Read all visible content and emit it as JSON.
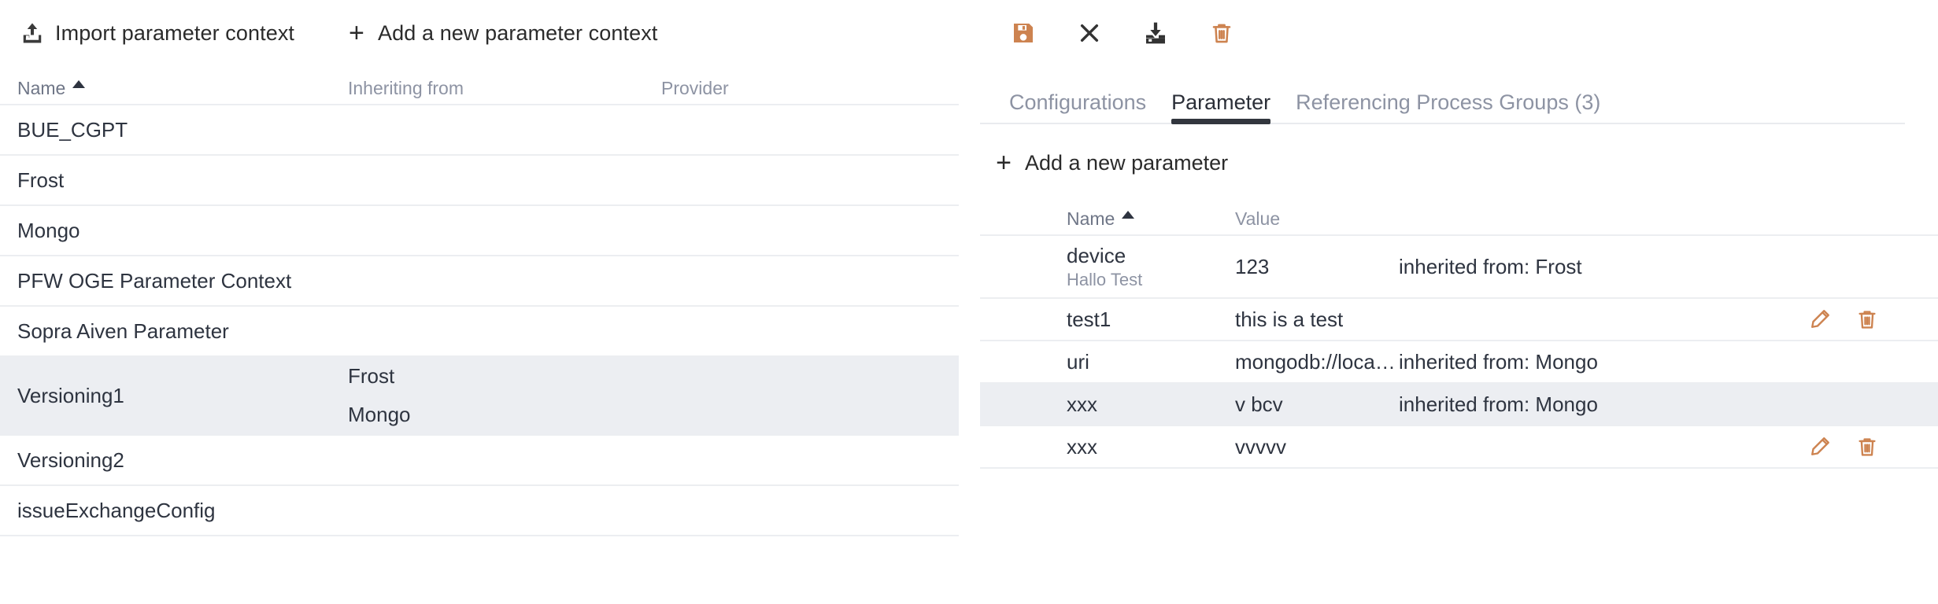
{
  "theme": {
    "accent_orange": "#cd8350",
    "text_dark": "#2e3440",
    "text_muted": "#8d93a3",
    "row_selected_bg": "#eceef2",
    "border": "#eceef1"
  },
  "left_pane": {
    "toolbar": {
      "import_label": "Import parameter context",
      "import_icon": "upload-icon",
      "add_label": "Add a new parameter context",
      "add_icon": "plus-icon"
    },
    "table": {
      "columns": [
        {
          "key": "name",
          "label": "Name",
          "sorted": true,
          "sort_dir": "asc"
        },
        {
          "key": "inheriting_from",
          "label": "Inheriting from",
          "sorted": false
        },
        {
          "key": "provider",
          "label": "Provider",
          "sorted": false
        }
      ],
      "rows": [
        {
          "name": "BUE_CGPT",
          "inheriting_from": [],
          "provider": "",
          "selected": false
        },
        {
          "name": "Frost",
          "inheriting_from": [],
          "provider": "",
          "selected": false
        },
        {
          "name": "Mongo",
          "inheriting_from": [],
          "provider": "",
          "selected": false
        },
        {
          "name": "PFW OGE Parameter Context",
          "inheriting_from": [],
          "provider": "",
          "selected": false
        },
        {
          "name": "Sopra Aiven Parameter",
          "inheriting_from": [],
          "provider": "",
          "selected": false
        },
        {
          "name": "Versioning1",
          "inheriting_from": [
            "Frost",
            "Mongo"
          ],
          "provider": "",
          "selected": true
        },
        {
          "name": "Versioning2",
          "inheriting_from": [],
          "provider": "",
          "selected": false
        },
        {
          "name": "issueExchangeConfig",
          "inheriting_from": [],
          "provider": "",
          "selected": false
        }
      ]
    }
  },
  "right_pane": {
    "toolbar": [
      {
        "name": "save-button",
        "icon": "save-icon",
        "color": "#cd8350"
      },
      {
        "name": "close-button",
        "icon": "close-icon",
        "color": "#333333"
      },
      {
        "name": "download-button",
        "icon": "download-icon",
        "color": "#333333"
      },
      {
        "name": "delete-button",
        "icon": "trash-icon",
        "color": "#cd8350"
      }
    ],
    "tabs": [
      {
        "label": "Configurations",
        "active": false
      },
      {
        "label": "Parameter",
        "active": true
      },
      {
        "label": "Referencing Process Groups (3)",
        "active": false
      }
    ],
    "add_parameter": {
      "label": "Add a new parameter",
      "icon": "plus-icon"
    },
    "table": {
      "columns": [
        {
          "key": "name",
          "label": "Name",
          "sorted": true,
          "sort_dir": "asc"
        },
        {
          "key": "value",
          "label": "Value",
          "sorted": false
        }
      ],
      "rows": [
        {
          "name": "device",
          "description": "Hallo Test",
          "value": "123",
          "inherited": "inherited from: Frost",
          "selected": false,
          "has_actions": false
        },
        {
          "name": "test1",
          "description": "",
          "value": "this is a test",
          "inherited": "",
          "selected": false,
          "has_actions": true
        },
        {
          "name": "uri",
          "description": "",
          "value": "mongodb://localhos...",
          "inherited": "inherited from: Mongo",
          "selected": false,
          "has_actions": false
        },
        {
          "name": "xxx",
          "description": "",
          "value": "v bcv",
          "inherited": "inherited from: Mongo",
          "selected": true,
          "has_actions": false
        },
        {
          "name": "xxx",
          "description": "",
          "value": "vvvvv",
          "inherited": "",
          "selected": false,
          "has_actions": true
        }
      ]
    }
  }
}
